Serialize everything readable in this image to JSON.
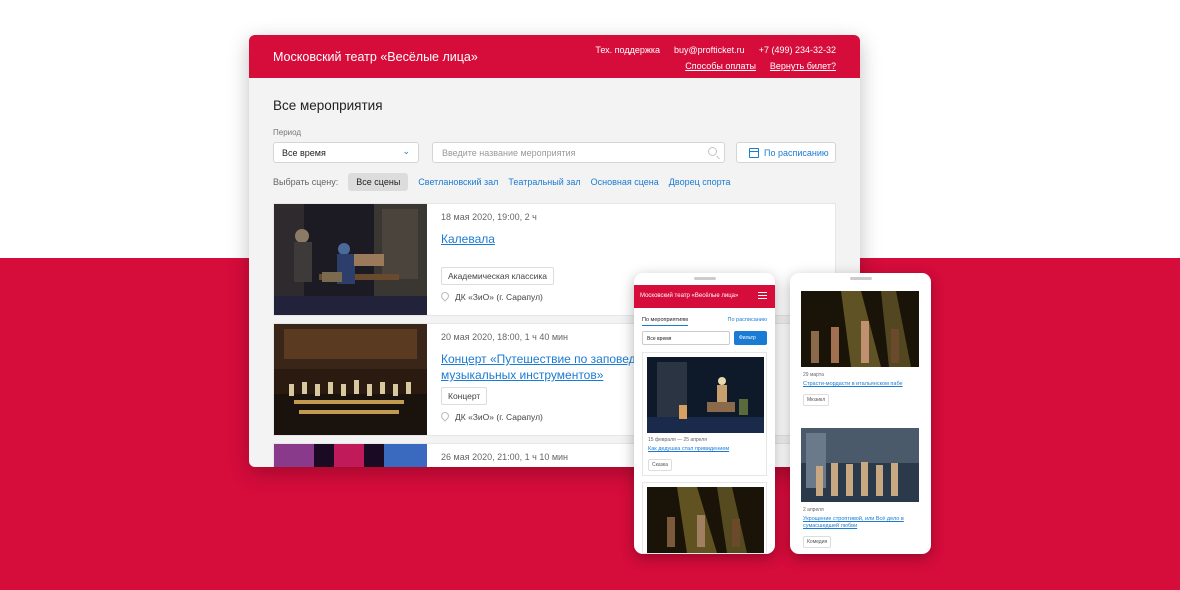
{
  "desktop": {
    "title": "Московский театр «Весёлые лица»",
    "support": "Тех. поддержка",
    "email": "buy@profticket.ru",
    "phone": "+7 (499) 234-32-32",
    "payment_link": "Способы оплаты",
    "refund_link": "Вернуть билет?",
    "heading": "Все мероприятия",
    "period_label": "Период",
    "period_value": "Все время",
    "search_placeholder": "Введите название мероприятия",
    "schedule_button": "По расписанию",
    "scene_label": "Выбрать сцену:",
    "scenes": [
      "Все сцены",
      "Светлановский зал",
      "Театральный зал",
      "Основная сцена",
      "Дворец спорта"
    ],
    "events": [
      {
        "date": "18 мая 2020, 19:00, 2 ч",
        "title": "Калевала",
        "tag": "Академическая классика",
        "venue": "ДК «ЗиО» (г. Сарапул)"
      },
      {
        "date": "20 мая 2020, 18:00, 1 ч 40 мин",
        "title": "Концерт «Путешествие по заповедным местам в стране музыкальных инструментов»",
        "tag": "Концерт",
        "venue": "ДК «ЗиО» (г. Сарапул)"
      },
      {
        "date": "26 мая 2020, 21:00, 1 ч 10 мин"
      }
    ]
  },
  "mobile1": {
    "title": "Московский театр «Весёлые лица»",
    "tab_active": "По мероприятиям",
    "tab_inactive": "По расписанию",
    "select_value": "Все время",
    "filter_button": "Фильтр",
    "card": {
      "date": "15 февраля — 25 апреля",
      "title": "Как дедушка стал привидением",
      "tag": "Сказка"
    }
  },
  "mobile2": {
    "cards": [
      {
        "date": "29 марта",
        "title": "Страсти-мордасти в итальянском пабе",
        "tag": "Мюзикл"
      },
      {
        "date": "2 апреля",
        "title": "Укрощение строптивой, или Всё дело в сумасшедшей любви",
        "tag": "Комедия"
      }
    ]
  },
  "colors": {
    "brand": "#d60c3b",
    "link": "#1a7bd4"
  },
  "icons": [
    "chevron-down-icon",
    "search-icon",
    "calendar-icon",
    "location-pin-icon",
    "menu-icon"
  ]
}
